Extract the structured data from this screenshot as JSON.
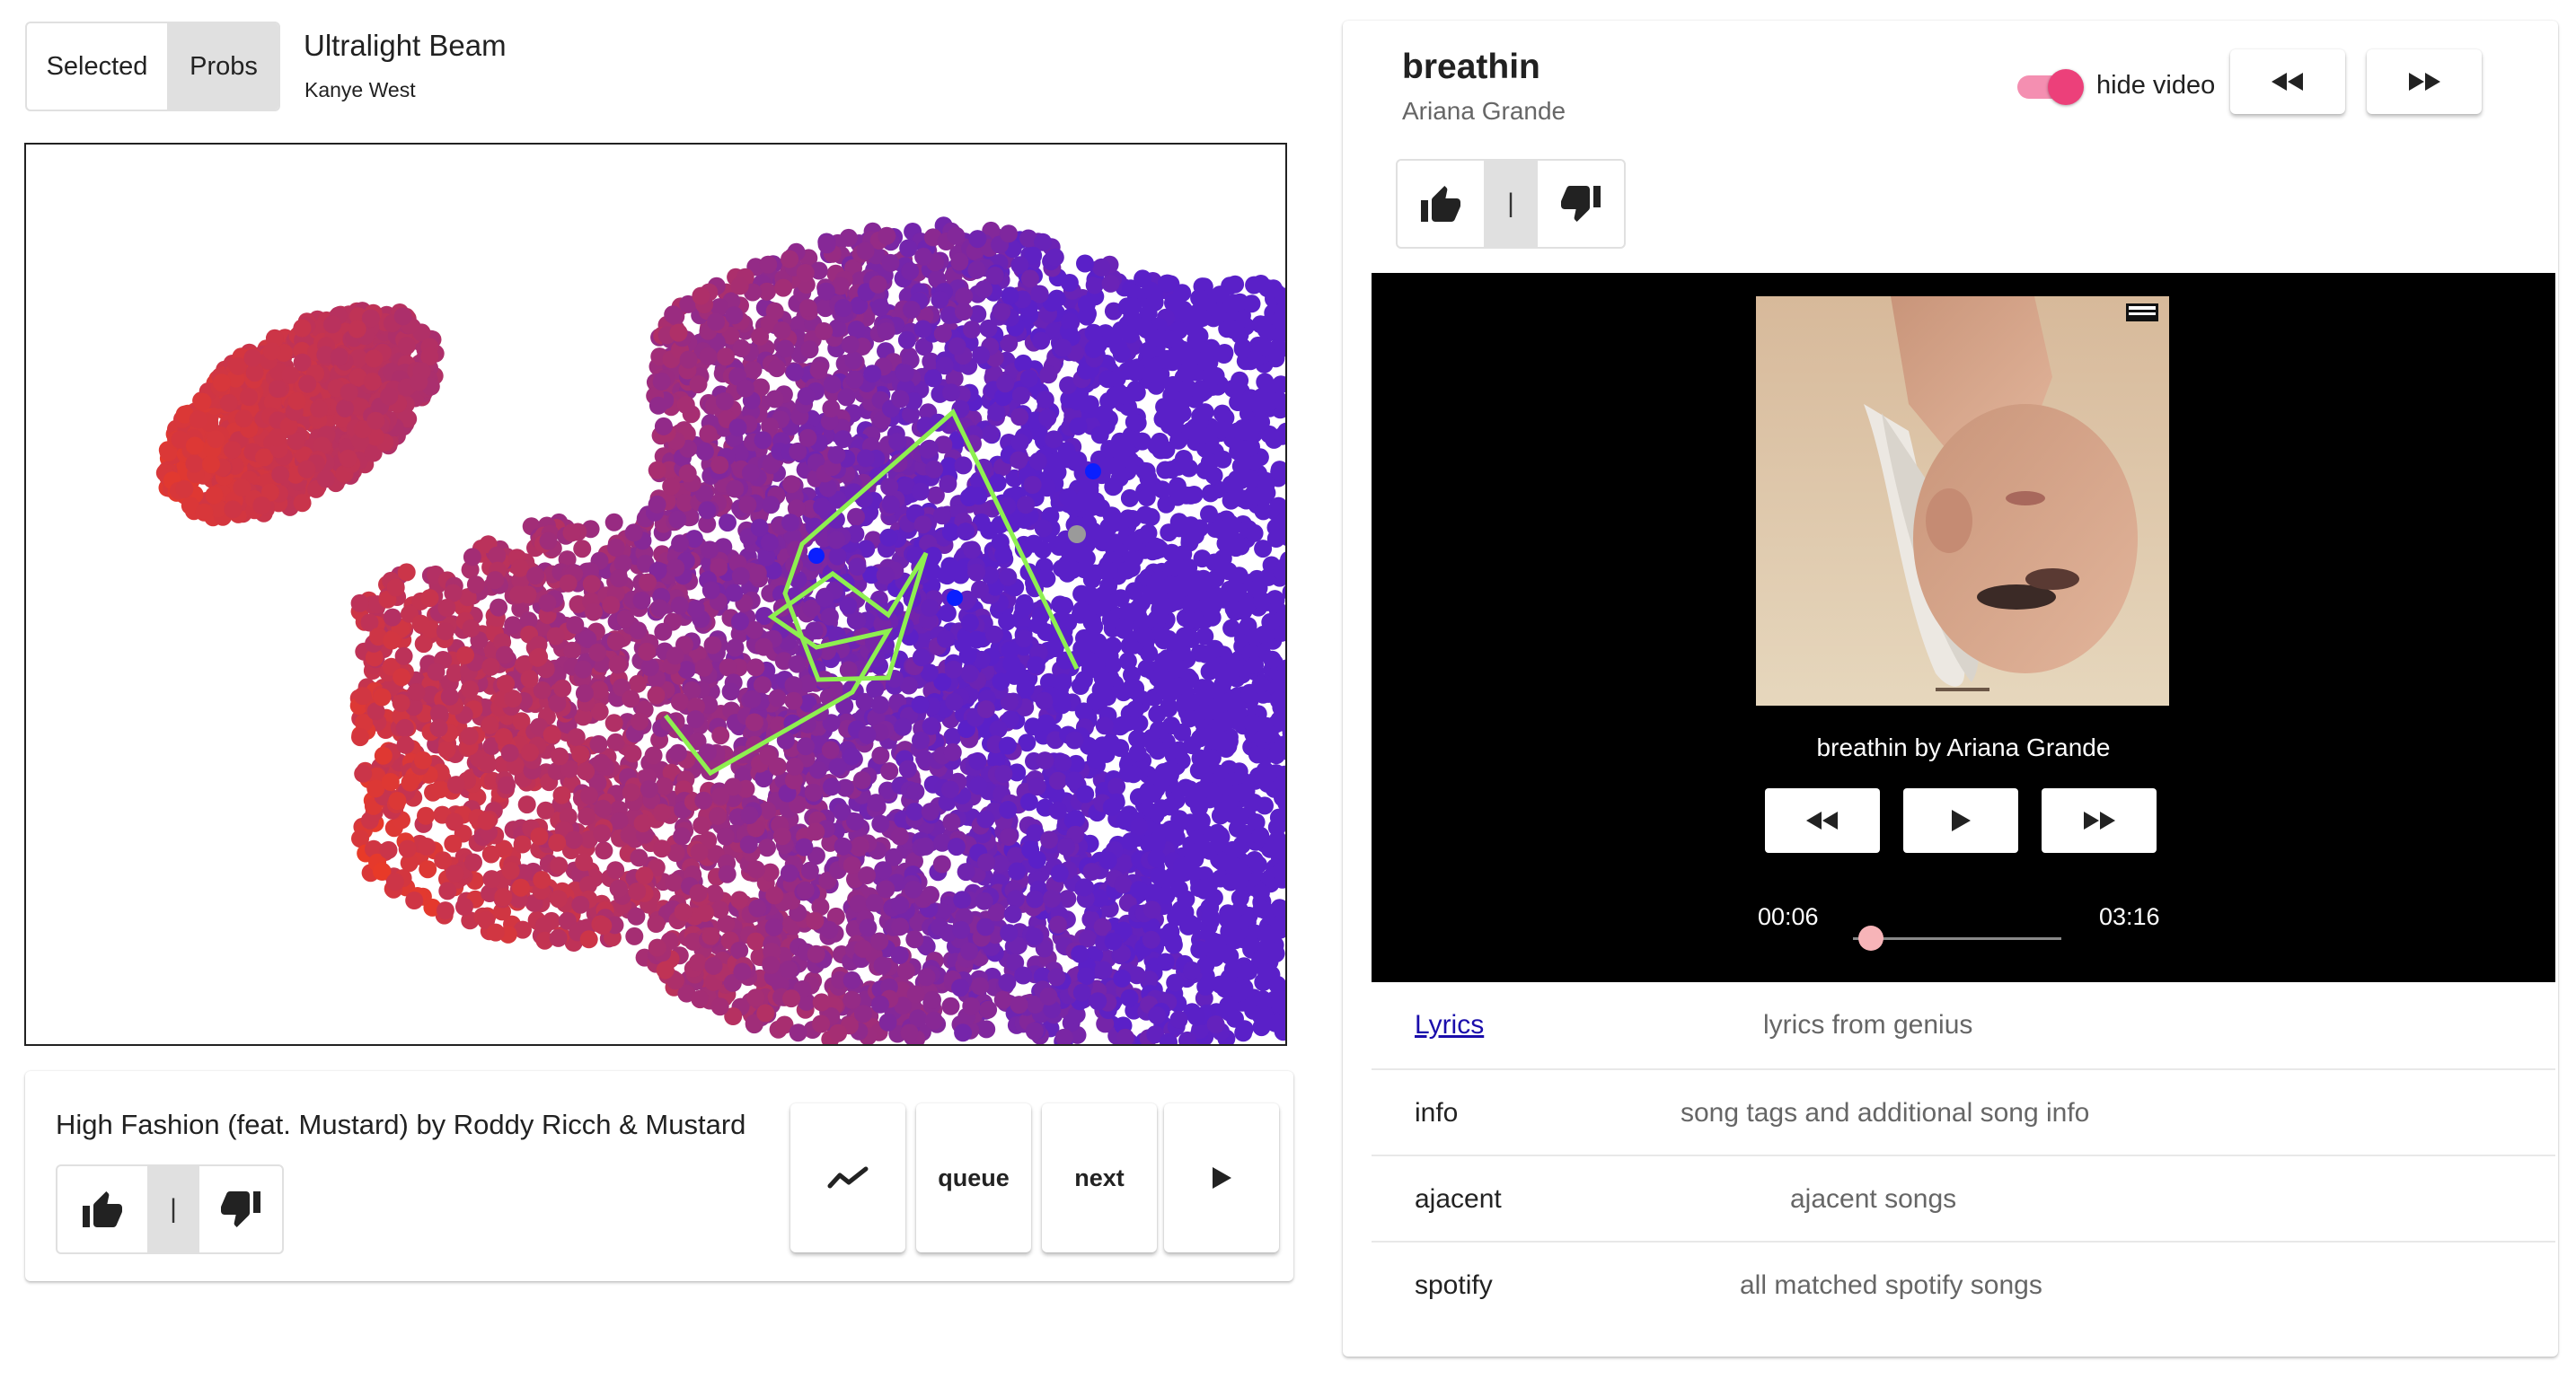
{
  "top_left": {
    "toggle": {
      "selected_label": "Selected",
      "probs_label": "Probs",
      "active": "probs"
    },
    "song_title": "Ultralight Beam",
    "song_artist": "Kanye West"
  },
  "scatter": {
    "colors": {
      "low": "#e83a28",
      "high": "#5a20c8",
      "path": "#8ef050",
      "selected_point": "#0a1fff",
      "current_point": "#9a9a9a"
    }
  },
  "bottom_left": {
    "song_line": "High Fashion (feat. Mustard) by Roddy Ricch & Mustard",
    "rating_divider": "|",
    "buttons": {
      "trend_icon": "trend-icon",
      "queue_label": "queue",
      "next_label": "next",
      "play_icon": "play-icon"
    }
  },
  "right_panel": {
    "now_playing_title": "breathin",
    "now_playing_artist": "Ariana Grande",
    "hide_video_label": "hide video",
    "hide_video_on": true,
    "rating_divider": "|",
    "player": {
      "caption": "breathin by Ariana Grande",
      "current_time": "00:06",
      "total_time": "03:16",
      "progress": 0.03
    },
    "info_rows": [
      {
        "label": "Lyrics",
        "description": "lyrics from genius",
        "is_link": true
      },
      {
        "label": "info",
        "description": "song tags and additional song info",
        "is_link": false
      },
      {
        "label": "ajacent",
        "description": "ajacent songs",
        "is_link": false
      },
      {
        "label": "spotify",
        "description": "all matched spotify songs",
        "is_link": false
      }
    ]
  },
  "accent_colors": {
    "toggle": "#ec407a",
    "link": "#1a0dab",
    "slider_thumb": "#f7b4b8"
  }
}
